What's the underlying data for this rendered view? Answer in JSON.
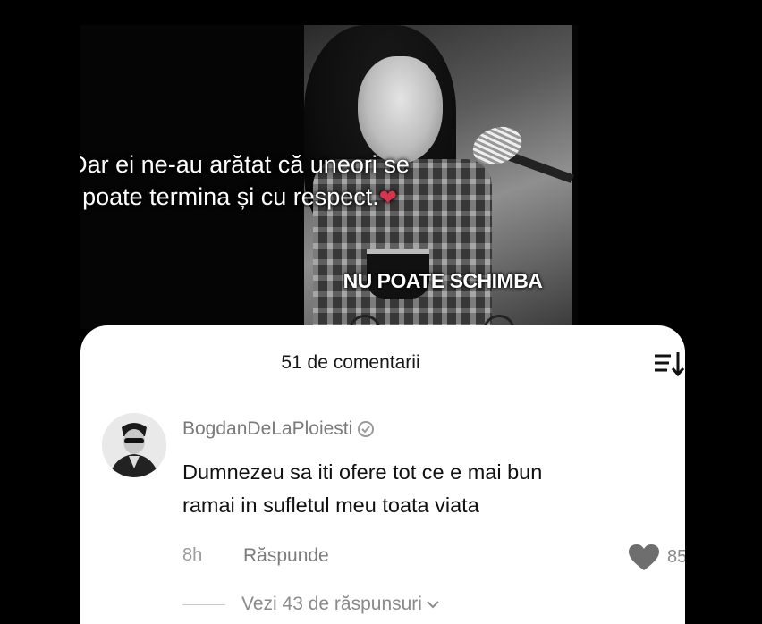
{
  "video": {
    "caption_line1": "Dar ei ne-au arătat că uneori se",
    "caption_line2": "poate termina și cu respect.",
    "caption_emoji": "❤",
    "overlay_text": "NU POATE SCHIMBA"
  },
  "comments": {
    "header": "51 de comentarii",
    "items": [
      {
        "username": "BogdanDeLaPloiesti",
        "text_line1": "Dumnezeu sa iti ofere tot ce e mai bun",
        "text_line2": "ramai in sufletul meu toata viata",
        "time": "8h",
        "reply_label": "Răspunde",
        "likes": "85",
        "view_replies": "Vezi 43 de răspunsuri"
      }
    ]
  },
  "icons": {
    "sort": "sort-icon",
    "verified": "verified-icon",
    "like": "heart-icon",
    "chevron": "chevron-down-icon"
  },
  "colors": {
    "heart_emoji": "#d9334d",
    "like_heart": "#6e6e6e"
  }
}
